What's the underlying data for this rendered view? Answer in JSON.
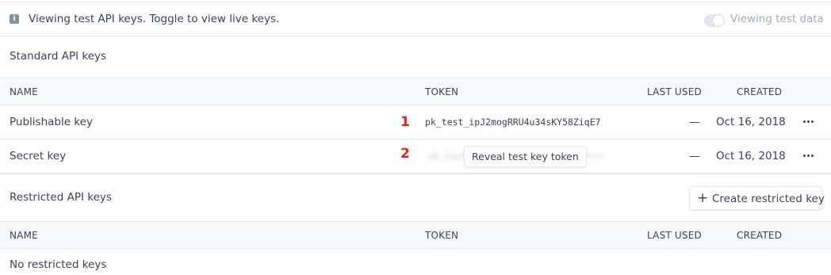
{
  "banner": {
    "message": "Viewing test API keys. Toggle to view live keys.",
    "toggle_label": "Viewing test data",
    "toggle_on": false
  },
  "standard": {
    "title": "Standard API keys",
    "columns": {
      "name": "NAME",
      "token": "TOKEN",
      "last_used": "LAST USED",
      "created": "CREATED"
    },
    "rows": [
      {
        "marker": "1",
        "name": "Publishable key",
        "token": "pk_test_ipJ2mogRRU4u34sKY58ZiqE7",
        "last_used": "—",
        "created": "Oct 16, 2018"
      },
      {
        "marker": "2",
        "name": "Secret key",
        "token": "sk_test_••••••••••••••••••••••••",
        "last_used": "—",
        "created": "Oct 16, 2018"
      }
    ],
    "reveal_label": "Reveal test key token"
  },
  "restricted": {
    "title": "Restricted API keys",
    "create_label": "Create restricted key",
    "columns": {
      "name": "NAME",
      "token": "TOKEN",
      "last_used": "LAST USED",
      "created": "CREATED"
    },
    "empty_text": "No restricted keys"
  },
  "icons": {
    "info": "info-icon",
    "more": "more-horizontal-icon",
    "plus": "plus-icon"
  },
  "colors": {
    "text": "#3c4257",
    "muted": "#a3acb9",
    "border": "#e3e8ee",
    "header_bg": "#f7fafc",
    "marker": "#d9262b"
  }
}
